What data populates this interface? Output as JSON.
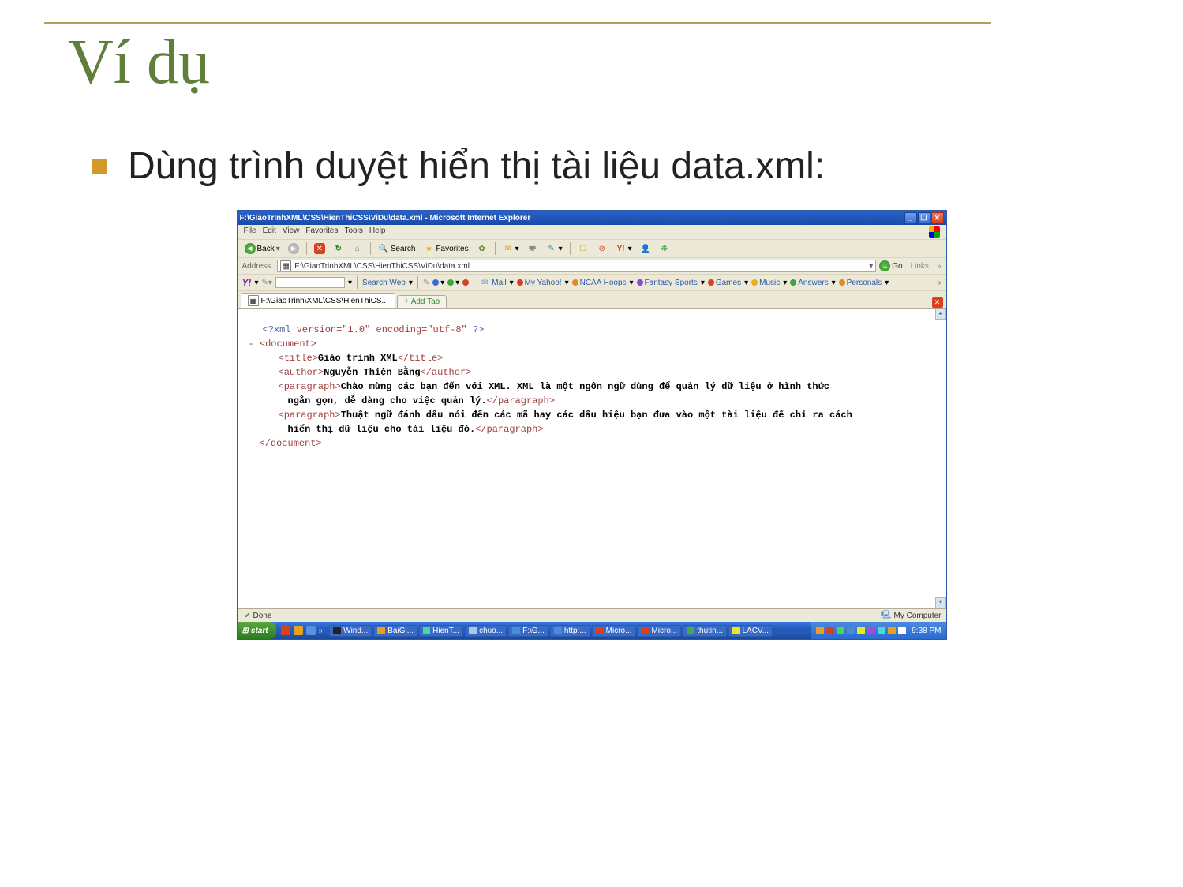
{
  "slide": {
    "title": "Ví dụ",
    "bullet": "Dùng trình duyệt hiển thị tài liệu data.xml:"
  },
  "titlebar": {
    "text": "F:\\GiaoTrinhXML\\CSS\\HienThiCSS\\ViDu\\data.xml - Microsoft Internet Explorer"
  },
  "menu": [
    "File",
    "Edit",
    "View",
    "Favorites",
    "Tools",
    "Help"
  ],
  "toolbar": {
    "back": "Back",
    "search": "Search",
    "favorites": "Favorites"
  },
  "addressbar": {
    "label": "Address",
    "value": "F:\\GiaoTrinhXML\\CSS\\HienThiCSS\\ViDu\\data.xml",
    "go": "Go",
    "links": "Links",
    "chev": "»"
  },
  "yahoo": {
    "brand": "Y!",
    "searchweb": "Search Web",
    "items": [
      "Mail",
      "My Yahoo!",
      "NCAA Hoops",
      "Fantasy Sports",
      "Games",
      "Music",
      "Answers",
      "Personals"
    ],
    "chev": "»"
  },
  "tabs": {
    "active": "F:\\GiaoTrinh\\XML\\CSS\\HienThiCS...",
    "add": "Add Tab"
  },
  "xml": {
    "decl_open": "<?xml",
    "decl_attrs": " version=\"1.0\" encoding=\"utf-8\" ",
    "decl_close": "?>",
    "dash": "- ",
    "doc_open": "<document>",
    "title_open": "<title>",
    "title_text": "Giáo trình XML",
    "title_close": "</title>",
    "author_open": "<author>",
    "author_text": "Nguyễn Thiện Bằng",
    "author_close": "</author>",
    "para1_open": "<paragraph>",
    "para1_text_a": "Chào mừng các bạn đến với XML. XML là một ngôn ngữ dùng để quản lý dữ liệu ở hình thức",
    "para1_text_b": "ngắn gọn, dễ dàng cho việc quản lý.",
    "para1_close": "</paragraph>",
    "para2_open": "<paragraph>",
    "para2_text_a": "Thuật ngữ đánh dấu nói đến các mã hay các dấu hiệu bạn đưa vào một tài liệu để chỉ ra cách",
    "para2_text_b": "hiển thị dữ liệu cho tài liệu đó.",
    "para2_close": "</paragraph>",
    "doc_close": "</document>"
  },
  "statusbar": {
    "done": "Done",
    "zone": "My Computer"
  },
  "taskbar": {
    "start": "start",
    "tasks": [
      "Wind...",
      "BaiGi...",
      "HienT...",
      "chuo...",
      "F:\\G...",
      "http:...",
      "Micro...",
      "Micro...",
      "thutin...",
      "LACV..."
    ],
    "clock": "9:38 PM"
  }
}
